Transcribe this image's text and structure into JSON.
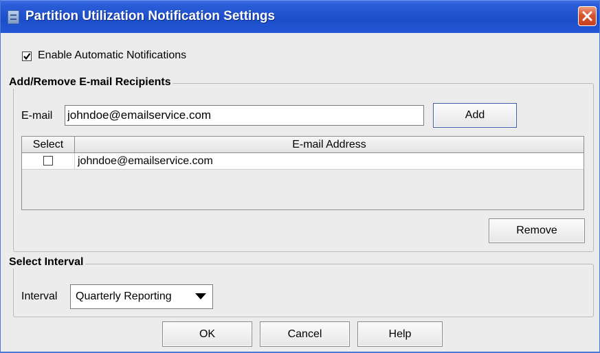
{
  "window": {
    "title": "Partition Utilization Notification Settings",
    "close_icon": "close-x-icon",
    "title_icon": "app-window-icon"
  },
  "notifications": {
    "enable_label": "Enable Automatic Notifications",
    "enabled": true
  },
  "recipients_group": {
    "title": "Add/Remove E-mail Recipients",
    "email_label": "E-mail",
    "email_value": "johndoe@emailservice.com",
    "add_label": "Add",
    "table": {
      "columns": [
        "Select",
        "E-mail Address"
      ],
      "rows": [
        {
          "selected": false,
          "email": "johndoe@emailservice.com"
        }
      ]
    },
    "remove_label": "Remove"
  },
  "interval_group": {
    "title": "Select Interval",
    "interval_label": "Interval",
    "selected_option": "Quarterly Reporting",
    "dropdown_icon": "dropdown-arrow-icon"
  },
  "footer": {
    "ok_label": "OK",
    "cancel_label": "Cancel",
    "help_label": "Help"
  },
  "colors": {
    "titlebar": "#2457d6",
    "close_button": "#d8542e",
    "dialog_background": "#ececec"
  }
}
